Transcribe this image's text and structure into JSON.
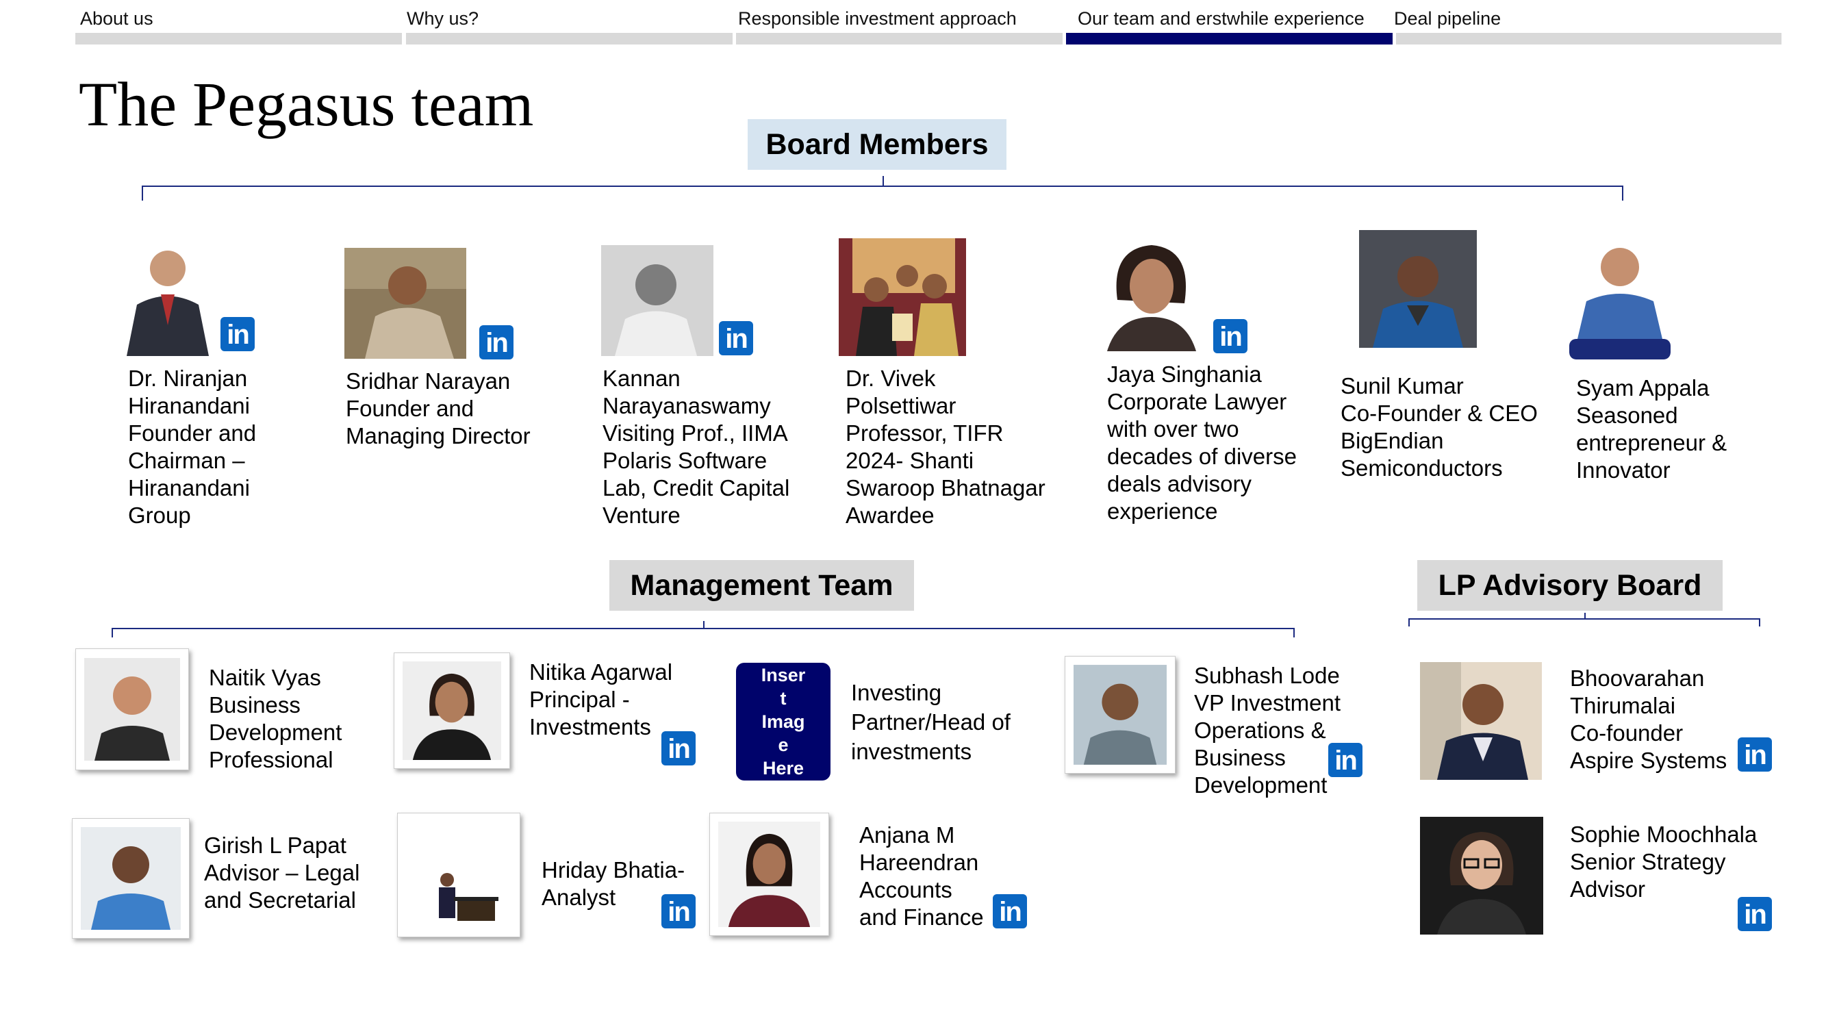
{
  "nav": {
    "tabs": [
      {
        "label": "About us"
      },
      {
        "label": "Why us?"
      },
      {
        "label": "Responsible investment approach"
      },
      {
        "label": "Our team and erstwhile experience"
      },
      {
        "label": "Deal pipeline"
      }
    ],
    "active_index": 3,
    "active_color": "#00046e",
    "inactive_color": "#d9d9d9"
  },
  "page_title": "The Pegasus team",
  "sections": {
    "board": "Board Members",
    "management": "Management Team",
    "lp": "LP Advisory Board"
  },
  "board_members": [
    {
      "text": "Dr. Niranjan\nHiranandani\nFounder and\nChairman –\nHiranandani\nGroup",
      "linkedin": true
    },
    {
      "text": "Sridhar Narayan\nFounder and\nManaging Director",
      "linkedin": true
    },
    {
      "text": "Kannan\nNarayanaswamy\nVisiting Prof., IIMA\nPolaris Software\nLab, Credit Capital\nVenture",
      "linkedin": true
    },
    {
      "text": "Dr. Vivek\nPolsettiwar\nProfessor, TIFR\n2024- Shanti\nSwaroop Bhatnagar\nAwardee",
      "linkedin": false
    },
    {
      "text": "Jaya Singhania\nCorporate Lawyer\nwith over two\ndecades of diverse\ndeals advisory\nexperience",
      "linkedin": true
    },
    {
      "text": "Sunil Kumar\nCo-Founder & CEO\nBigEndian\nSemiconductors",
      "linkedin": false
    },
    {
      "text": "Syam Appala\nSeasoned\nentrepreneur &\nInnovator",
      "linkedin": false
    }
  ],
  "management": [
    {
      "text": "Naitik Vyas\nBusiness\nDevelopment\nProfessional",
      "linkedin": false
    },
    {
      "text": "Nitika Agarwal\nPrincipal -\nInvestments",
      "linkedin": true
    },
    {
      "text": "Investing\nPartner/Head of\ninvestments",
      "linkedin": false,
      "placeholder": "Inser\nt\nImag\ne\nHere"
    },
    {
      "text": "Subhash Lode\nVP Investment\nOperations &\nBusiness\nDevelopment",
      "linkedin": true
    },
    {
      "text": "Girish L Papat\nAdvisor – Legal\nand Secretarial",
      "linkedin": false
    },
    {
      "text": "Hriday Bhatia-\nAnalyst",
      "linkedin": true
    },
    {
      "text": "Anjana M\nHareendran\nAccounts\nand Finance",
      "linkedin": true
    }
  ],
  "lp_advisory": [
    {
      "text": "Bhoovarahan\nThirumalai\nCo-founder\nAspire Systems",
      "linkedin": true
    },
    {
      "text": "Sophie Moochhala\nSenior Strategy\nAdvisor",
      "linkedin": true
    }
  ],
  "linkedin_glyph": "in",
  "colors": {
    "linkedin": "#0a66c2",
    "bracket": "#1b2a80",
    "board_header_bg": "#d6e4f0",
    "gray_header_bg": "#d9d9d9"
  }
}
